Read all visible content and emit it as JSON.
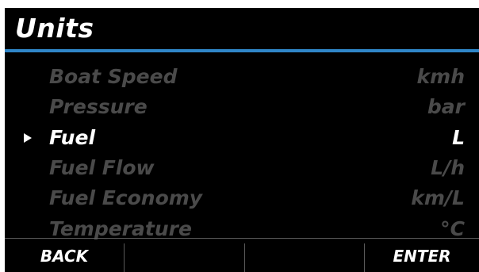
{
  "header": {
    "title": "Units",
    "accent_color": "#2f86c8"
  },
  "units_list": {
    "selected_index": 2,
    "items": [
      {
        "label": "Boat Speed",
        "value": "kmh"
      },
      {
        "label": "Pressure",
        "value": "bar"
      },
      {
        "label": "Fuel",
        "value": "L"
      },
      {
        "label": "Fuel Flow",
        "value": "L/h"
      },
      {
        "label": "Fuel Economy",
        "value": "km/L"
      },
      {
        "label": "Temperature",
        "value": "°C"
      }
    ]
  },
  "softkeys": {
    "back_label": "BACK",
    "key2_label": "",
    "key3_label": "",
    "enter_label": "ENTER"
  }
}
